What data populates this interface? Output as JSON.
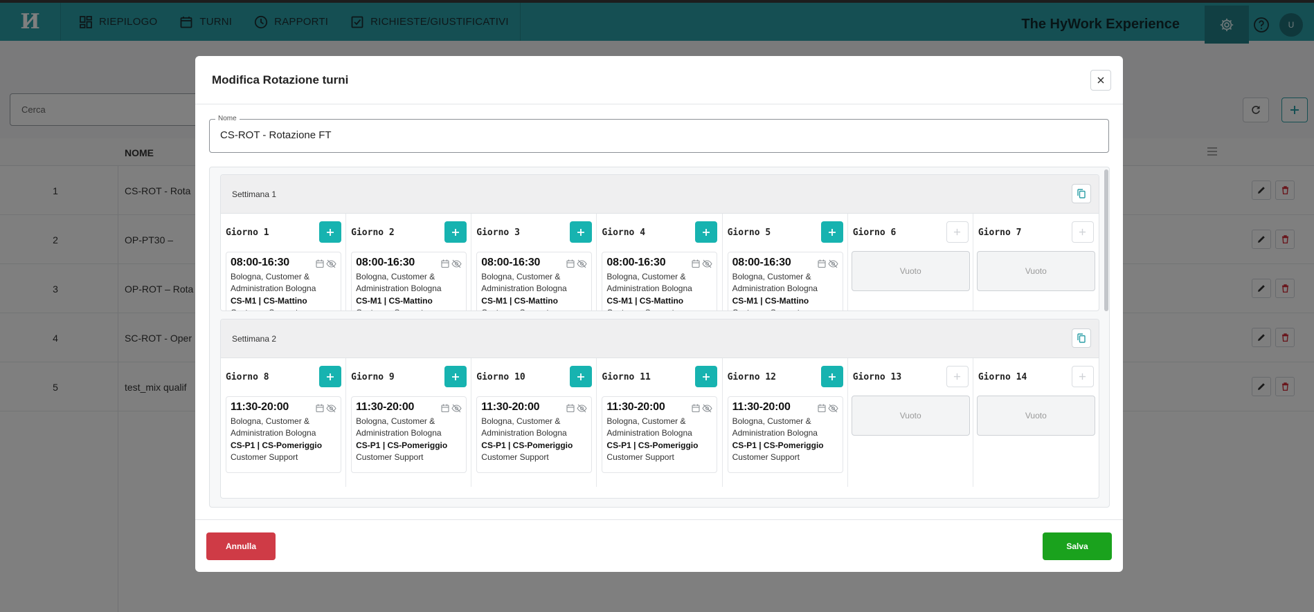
{
  "nav": {
    "logo": "И",
    "items": [
      {
        "label": "RIEPILOGO",
        "icon": "dashboard-icon"
      },
      {
        "label": "TURNI",
        "icon": "calendar-icon"
      },
      {
        "label": "RAPPORTI",
        "icon": "clock-icon"
      },
      {
        "label": "RICHIESTE/GIUSTIFICATIVI",
        "icon": "checkbox-icon"
      }
    ],
    "brand": "The HyWork Experience",
    "avatar": "U",
    "accent": "#2b9ea6"
  },
  "background": {
    "search_placeholder": "Cerca",
    "column_name": "NOME",
    "rows": [
      {
        "idx": "1",
        "name": "CS-ROT - Rota"
      },
      {
        "idx": "2",
        "name": "OP-PT30 –"
      },
      {
        "idx": "3",
        "name": "OP-ROT – Rota"
      },
      {
        "idx": "4",
        "name": "SC-ROT - Oper"
      },
      {
        "idx": "5",
        "name": "test_mix qualif"
      }
    ]
  },
  "modal": {
    "title": "Modifica Rotazione turni",
    "name_label": "Nome",
    "name_value": "CS-ROT - Rotazione FT",
    "empty_label": "Vuoto",
    "weeks": [
      {
        "title": "Settimana 1",
        "days": [
          {
            "label": "Giorno 1",
            "shift": {
              "time": "08:00-16:30",
              "loc1": "Bologna, Customer &",
              "loc2": "Administration Bologna",
              "code": "CS-M1 | CS-Mattino",
              "dept": "Customer Support"
            }
          },
          {
            "label": "Giorno 2",
            "shift": {
              "time": "08:00-16:30",
              "loc1": "Bologna, Customer &",
              "loc2": "Administration Bologna",
              "code": "CS-M1 | CS-Mattino",
              "dept": "Customer Support"
            }
          },
          {
            "label": "Giorno 3",
            "shift": {
              "time": "08:00-16:30",
              "loc1": "Bologna, Customer &",
              "loc2": "Administration Bologna",
              "code": "CS-M1 | CS-Mattino",
              "dept": "Customer Support"
            }
          },
          {
            "label": "Giorno 4",
            "shift": {
              "time": "08:00-16:30",
              "loc1": "Bologna, Customer &",
              "loc2": "Administration Bologna",
              "code": "CS-M1 | CS-Mattino",
              "dept": "Customer Support"
            }
          },
          {
            "label": "Giorno 5",
            "shift": {
              "time": "08:00-16:30",
              "loc1": "Bologna, Customer &",
              "loc2": "Administration Bologna",
              "code": "CS-M1 | CS-Mattino",
              "dept": "Customer Support"
            }
          },
          {
            "label": "Giorno 6"
          },
          {
            "label": "Giorno 7"
          }
        ]
      },
      {
        "title": "Settimana 2",
        "days": [
          {
            "label": "Giorno 8",
            "shift": {
              "time": "11:30-20:00",
              "loc1": "Bologna, Customer &",
              "loc2": "Administration Bologna",
              "code": "CS-P1 | CS-Pomeriggio",
              "dept": "Customer Support"
            }
          },
          {
            "label": "Giorno 9",
            "shift": {
              "time": "11:30-20:00",
              "loc1": "Bologna, Customer &",
              "loc2": "Administration Bologna",
              "code": "CS-P1 | CS-Pomeriggio",
              "dept": "Customer Support"
            }
          },
          {
            "label": "Giorno 10",
            "shift": {
              "time": "11:30-20:00",
              "loc1": "Bologna, Customer &",
              "loc2": "Administration Bologna",
              "code": "CS-P1 | CS-Pomeriggio",
              "dept": "Customer Support"
            }
          },
          {
            "label": "Giorno 11",
            "shift": {
              "time": "11:30-20:00",
              "loc1": "Bologna, Customer &",
              "loc2": "Administration Bologna",
              "code": "CS-P1 | CS-Pomeriggio",
              "dept": "Customer Support"
            }
          },
          {
            "label": "Giorno 12",
            "shift": {
              "time": "11:30-20:00",
              "loc1": "Bologna, Customer &",
              "loc2": "Administration Bologna",
              "code": "CS-P1 | CS-Pomeriggio",
              "dept": "Customer Support"
            }
          },
          {
            "label": "Giorno 13"
          },
          {
            "label": "Giorno 14"
          }
        ]
      }
    ],
    "cancel_label": "Annulla",
    "save_label": "Salva",
    "colors": {
      "add": "#17b3b0",
      "cancel": "#cf3b46",
      "save": "#1aa21d"
    }
  }
}
